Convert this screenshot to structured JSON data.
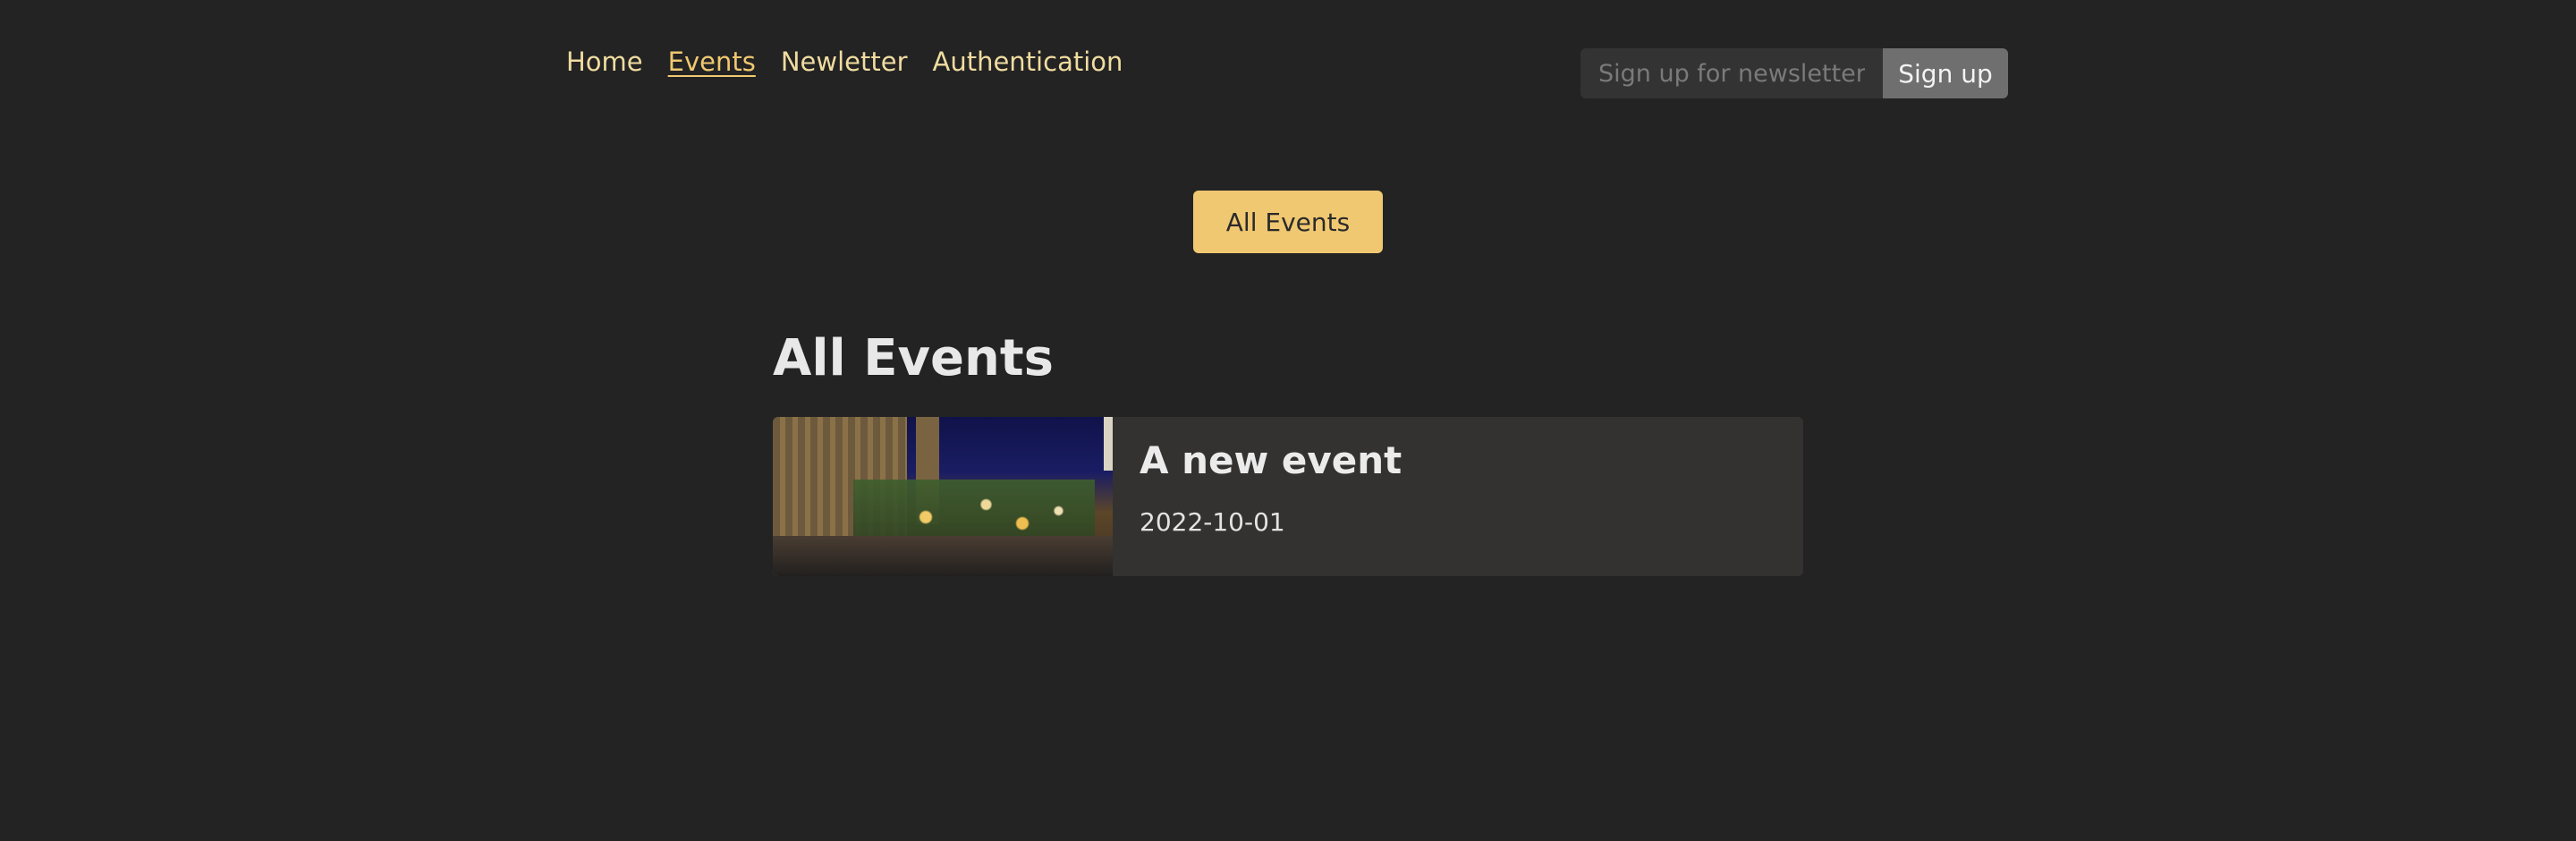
{
  "nav": {
    "items": [
      {
        "label": "Home",
        "active": false
      },
      {
        "label": "Events",
        "active": true
      },
      {
        "label": "Newletter",
        "active": false
      },
      {
        "label": "Authentication",
        "active": false
      }
    ]
  },
  "newsletter": {
    "placeholder": "Sign up for newsletter...",
    "button_label": "Sign up"
  },
  "events_toolbar": {
    "all_events_label": "All Events"
  },
  "main": {
    "title": "All Events",
    "events": [
      {
        "title": "A new event",
        "date": "2022-10-01",
        "image_icon": "christmas-market-image"
      }
    ]
  },
  "colors": {
    "background": "#232323",
    "accent": "#f0c871",
    "card": "#333231",
    "nav_text": "#f0dca0"
  }
}
